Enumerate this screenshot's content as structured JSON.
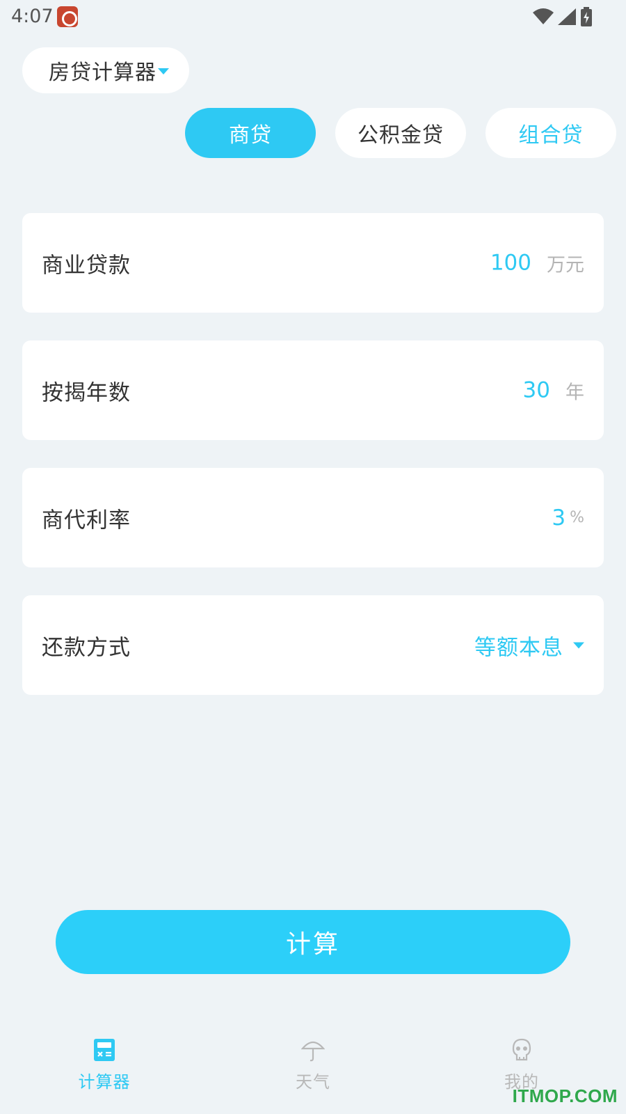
{
  "status_bar": {
    "time": "4:07",
    "app_icon": "weibo-like-app-icon",
    "icons": [
      "wifi-icon",
      "signal-icon",
      "battery-charging-icon"
    ]
  },
  "calculator_selector": {
    "label": "房贷计算器",
    "icon": "caret-down-icon"
  },
  "loan_tabs": [
    {
      "label": "商贷",
      "active": true
    },
    {
      "label": "公积金贷",
      "active": false
    },
    {
      "label": "组合贷",
      "active": false
    }
  ],
  "form": {
    "loan_amount": {
      "label": "商业贷款",
      "value": "100",
      "unit": "万元"
    },
    "years": {
      "label": "按揭年数",
      "value": "30",
      "unit": "年"
    },
    "rate": {
      "label": "商代利率",
      "value": "3",
      "unit": "%"
    },
    "repayment": {
      "label": "还款方式",
      "value": "等额本息",
      "icon": "caret-down-icon"
    }
  },
  "calculate_button": {
    "label": "计算"
  },
  "bottom_nav": [
    {
      "label": "计算器",
      "icon": "calculator-icon",
      "active": true
    },
    {
      "label": "天气",
      "icon": "umbrella-icon",
      "active": false
    },
    {
      "label": "我的",
      "icon": "skull-icon",
      "active": false
    }
  ],
  "watermark": "ITMOP.COM",
  "colors": {
    "accent": "#2ec9f3",
    "button": "#2ccff9",
    "background": "#eef3f6",
    "text": "#333333",
    "muted": "#b4b4b4"
  }
}
